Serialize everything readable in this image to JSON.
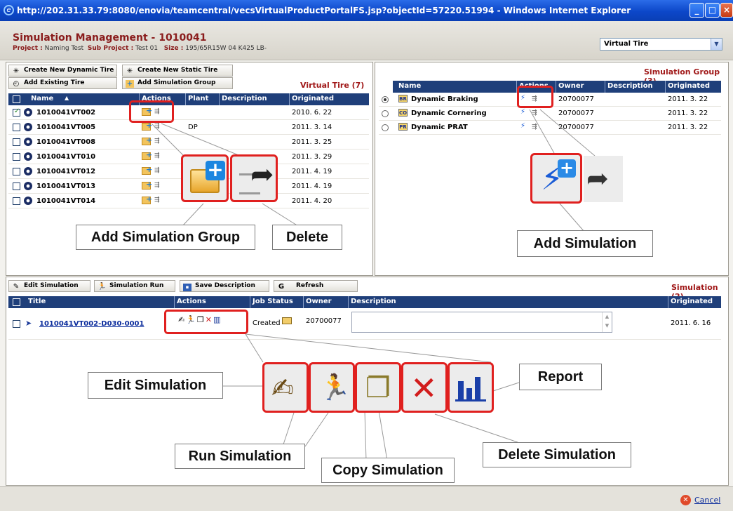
{
  "window": {
    "title": "http://202.31.33.79:8080/enovia/teamcentral/vecsVirtualProductPortalFS.jsp?objectId=57220.51994 - Windows Internet Explorer"
  },
  "header": {
    "title": "Simulation Management  -  1010041",
    "project_label": "Project :",
    "project": "Naming Test",
    "subproject_label": "Sub Project :",
    "subproject": "Test 01",
    "size_label": "Size :",
    "size": "195/65R15W 04 K425 LB-",
    "select_value": "Virtual Tire"
  },
  "tire_panel": {
    "buttons": {
      "create_dynamic": "Create New Dynamic Tire",
      "create_static": "Create New Static Tire",
      "add_existing": "Add Existing Tire",
      "add_group": "Add Simulation Group"
    },
    "title": "Virtual Tire (7)",
    "columns": {
      "name": "Name",
      "actions": "Actions",
      "plant": "Plant",
      "description": "Description",
      "originated": "Originated"
    },
    "rows": [
      {
        "name": "1010041VT002",
        "plant": "",
        "originated": "2010. 6. 22",
        "checked": true
      },
      {
        "name": "1010041VT005",
        "plant": "DP",
        "originated": "2011. 3. 14",
        "checked": false
      },
      {
        "name": "1010041VT008",
        "plant": "",
        "originated": "2011. 3. 25",
        "checked": false
      },
      {
        "name": "1010041VT010",
        "plant": "",
        "originated": "2011. 3. 29",
        "checked": false
      },
      {
        "name": "1010041VT012",
        "plant": "",
        "originated": "2011. 4. 19",
        "checked": false
      },
      {
        "name": "1010041VT013",
        "plant": "",
        "originated": "2011. 4. 19",
        "checked": false
      },
      {
        "name": "1010041VT014",
        "plant": "",
        "originated": "2011. 4. 20",
        "checked": false
      }
    ],
    "callouts": {
      "add_group": "Add Simulation Group",
      "delete": "Delete"
    }
  },
  "group_panel": {
    "title": "Simulation Group (3)",
    "columns": {
      "name": "Name",
      "actions": "Actions",
      "owner": "Owner",
      "description": "Description",
      "originated": "Originated"
    },
    "rows": [
      {
        "badge": "BR",
        "name": "Dynamic Braking",
        "owner": "20700077",
        "originated": "2011. 3. 22",
        "selected": true
      },
      {
        "badge": "CO",
        "name": "Dynamic Cornering",
        "owner": "20700077",
        "originated": "2011. 3. 22",
        "selected": false
      },
      {
        "badge": "PR",
        "name": "Dynamic PRAT",
        "owner": "20700077",
        "originated": "2011. 3. 22",
        "selected": false
      }
    ],
    "callouts": {
      "add_simulation": "Add Simulation"
    }
  },
  "simulation_panel": {
    "buttons": {
      "edit": "Edit Simulation",
      "run": "Simulation Run",
      "save": "Save Description",
      "refresh": "Refresh"
    },
    "title": "Simulation (2)",
    "columns": {
      "title": "Title",
      "actions": "Actions",
      "job_status": "Job Status",
      "owner": "Owner",
      "description": "Description",
      "originated": "Originated"
    },
    "rows": [
      {
        "title": "1010041VT002-D030-0001",
        "status": "Created",
        "owner": "20700077",
        "originated": "2011. 6. 16"
      }
    ],
    "callouts": {
      "edit": "Edit Simulation",
      "report": "Report",
      "run": "Run Simulation",
      "copy": "Copy Simulation",
      "delete": "Delete Simulation"
    }
  },
  "footer": {
    "cancel": "Cancel"
  }
}
